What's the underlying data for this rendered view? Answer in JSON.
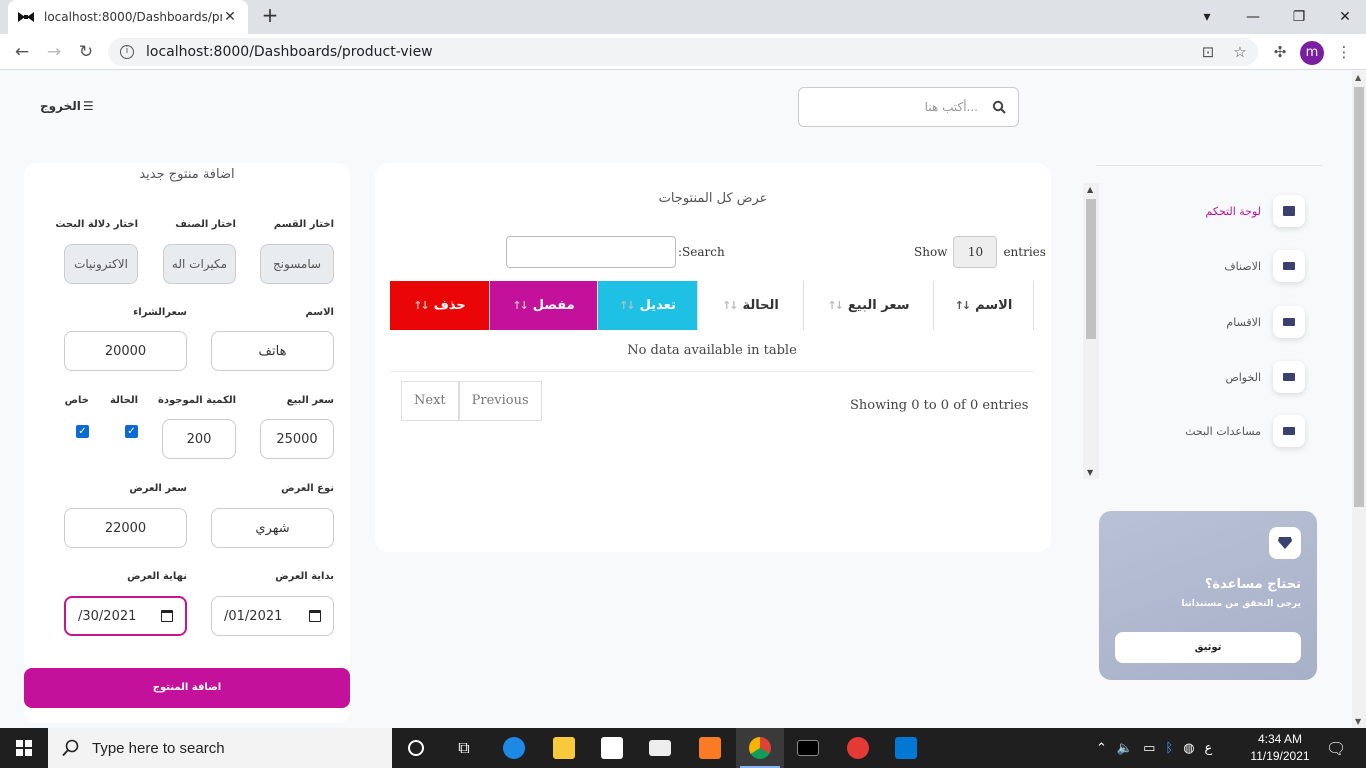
{
  "browser": {
    "tab_title": "localhost:8000/Dashboards/prod",
    "url": "localhost:8000/Dashboards/product-view",
    "profile_initial": "m"
  },
  "header": {
    "logout_label": "الخروج",
    "search_placeholder": "أكتب هنا..."
  },
  "form": {
    "title": "اضافة منتوج جديد",
    "labels": {
      "category": "اختار القسم",
      "type": "اختار الصنف",
      "keyword": "اختار دلالة البحث",
      "name": "الاسم",
      "buy_price": "سعرالشراء",
      "sell_price": "سعر البيع",
      "quantity": "الكمية الموجودة",
      "status": "الحالة",
      "special": "خاص",
      "offer_type": "نوع العرض",
      "offer_price": "سعر العرض",
      "offer_start": "بداية العرض",
      "offer_end": "نهاية العرض"
    },
    "values": {
      "category": "سامسونج",
      "type": "مكيرات اله",
      "keyword": "الاكترونيات",
      "name": "هاتف",
      "buy_price": "20000",
      "sell_price": "25000",
      "quantity": "200",
      "status_checked": true,
      "special_checked": true,
      "offer_type": "شهري",
      "offer_price": "22000",
      "offer_start": "/01/2021",
      "offer_end": "/30/2021"
    },
    "submit_label": "اضافة المنتوج"
  },
  "table": {
    "title": "عرض كل المنتوجات",
    "search_label": ":Search",
    "show_label": "Show",
    "entries_value": "10",
    "entries_label": "entries",
    "columns": [
      {
        "label": "الاسم",
        "color": "#ffffff"
      },
      {
        "label": "سعر البيع",
        "color": "#ffffff"
      },
      {
        "label": "الحالة",
        "color": "#ffffff"
      },
      {
        "label": "تعديل",
        "color": "#1ec1e4"
      },
      {
        "label": "مفصل",
        "color": "#c3119b"
      },
      {
        "label": "حذف",
        "color": "#ea0606"
      }
    ],
    "empty_message": "No data available in table",
    "info": "Showing 0 to 0 of 0 entries",
    "previous_label": "Previous",
    "next_label": "Next"
  },
  "sidebar": {
    "items": [
      {
        "label": "لوحة التحكم",
        "active": true
      },
      {
        "label": "الاصناف",
        "active": false
      },
      {
        "label": "الاقسام",
        "active": false
      },
      {
        "label": "الخواص",
        "active": false
      },
      {
        "label": "مساعدات البحث",
        "active": false
      }
    ],
    "help": {
      "title": "تحتاج مساعدة؟",
      "subtitle": "يرجى التحقق من مستنداتنا",
      "button_label": "توثيق"
    }
  },
  "taskbar": {
    "search_placeholder": "Type here to search",
    "time": "4:34 AM",
    "date": "11/19/2021",
    "lang": "ع"
  },
  "colors": {
    "accent": "#c3119b",
    "info": "#1ec1e4",
    "danger": "#ea0606"
  }
}
